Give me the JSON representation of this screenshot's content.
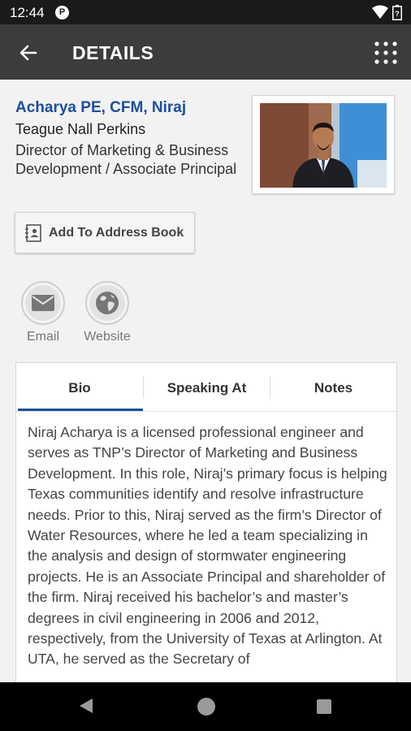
{
  "status_bar": {
    "time": "12:44",
    "notification_icon": "p-circle-icon"
  },
  "app_bar": {
    "title": "DETAILS",
    "back_icon": "arrow-left-icon",
    "menu_icon": "grid-icon"
  },
  "profile": {
    "name": "Acharya PE, CFM, Niraj",
    "company": "Teague Nall Perkins",
    "title": "Director of Marketing & Business Development / Associate Principal"
  },
  "address_book": {
    "label": "Add To Address Book",
    "icon": "contact-card-icon"
  },
  "contacts": [
    {
      "label": "Email",
      "icon": "envelope-icon"
    },
    {
      "label": "Website",
      "icon": "globe-icon"
    }
  ],
  "tabs": [
    {
      "label": "Bio",
      "active": true
    },
    {
      "label": "Speaking At",
      "active": false
    },
    {
      "label": "Notes",
      "active": false
    }
  ],
  "bio": "Niraj Acharya is a licensed professional engineer and serves as TNP’s Director of Marketing and Business Development. In this role, Niraj’s primary focus is helping Texas communities identify and resolve infrastructure needs. Prior to this, Niraj served as the firm’s Director of Water Resources, where he led a team specializing in the analysis and design of stormwater engineering projects. He is an Associate Principal and shareholder of the firm. Niraj received his bachelor’s and master’s degrees in civil engineering in 2006 and 2012, respectively, from the University of Texas at Arlington. At UTA, he served as the Secretary of",
  "colors": {
    "accent": "#1b4f9c",
    "app_bar": "#3c3c3c",
    "status_bar": "#1a1a1a",
    "background": "#f2f2f2"
  }
}
